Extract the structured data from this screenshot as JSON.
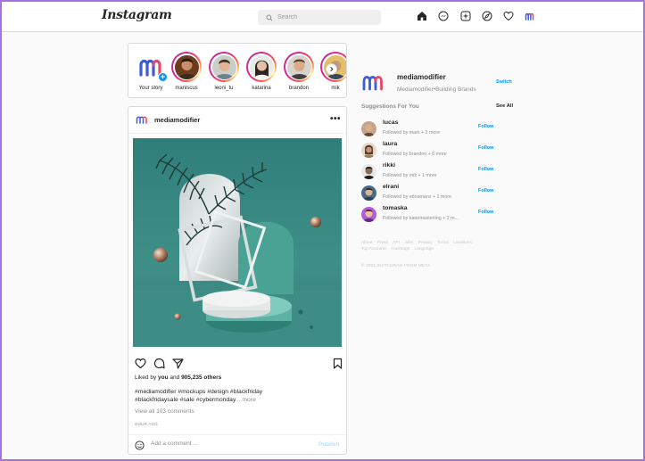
{
  "brand": {
    "logo_text": "Instagram",
    "accent": "#0095f6",
    "ring": "#d6249f"
  },
  "search": {
    "placeholder": "Search"
  },
  "nav": {
    "icons": [
      "home-icon",
      "messenger-icon",
      "new-post-icon",
      "explore-icon",
      "activity-heart-icon",
      "profile-avatar-icon"
    ]
  },
  "stories": [
    {
      "label": "Your story"
    },
    {
      "label": "maniscus"
    },
    {
      "label": "leoni_tu"
    },
    {
      "label": "katarina"
    },
    {
      "label": "brandon"
    },
    {
      "label": "mik"
    }
  ],
  "post": {
    "username": "mediamodifier",
    "more": "•••",
    "liked_prefix": "Liked by ",
    "liked_you": "you",
    "liked_mid": " and ",
    "liked_count": "905,235 others",
    "caption_line1": "#mediamodifier #mockups #design #blackfriday",
    "caption_line2": "#blackfridaysale #sale #cybermonday",
    "caption_more": "... more",
    "view_comments": "View all 103 comments",
    "time_ago": "HOUR AGO",
    "comment_placeholder": "Add a comment ...",
    "publish": "Publish"
  },
  "sidebar": {
    "username": "mediamodifier",
    "subtitle": "Mediamodifier•Building Brands",
    "switch": "Switch",
    "suggestions_title": "Suggestions For You",
    "see_all": "See All",
    "suggestions": [
      {
        "name": "lucas",
        "sub": "Followed by mark + 2 more",
        "action": "Follow"
      },
      {
        "name": "laura",
        "sub": "Followed by brandon + 6 more",
        "action": "Follow"
      },
      {
        "name": "rikki",
        "sub": "Followed by mik + 1 more",
        "action": "Follow"
      },
      {
        "name": "elrani",
        "sub": "Followed by ednamanz + 1 more",
        "action": "Follow"
      },
      {
        "name": "tomaska",
        "sub": "Followed by katarinasterling + 2 m...",
        "action": "Follow"
      }
    ],
    "footer_row1": [
      "About",
      "Press",
      "API",
      "Jobs",
      "Privacy",
      "Terms",
      "Locations"
    ],
    "footer_row2": [
      "Top Accounts",
      "Hashtags",
      "Language"
    ],
    "copyright": "© 2021 INSTAGRAM FROM META"
  }
}
